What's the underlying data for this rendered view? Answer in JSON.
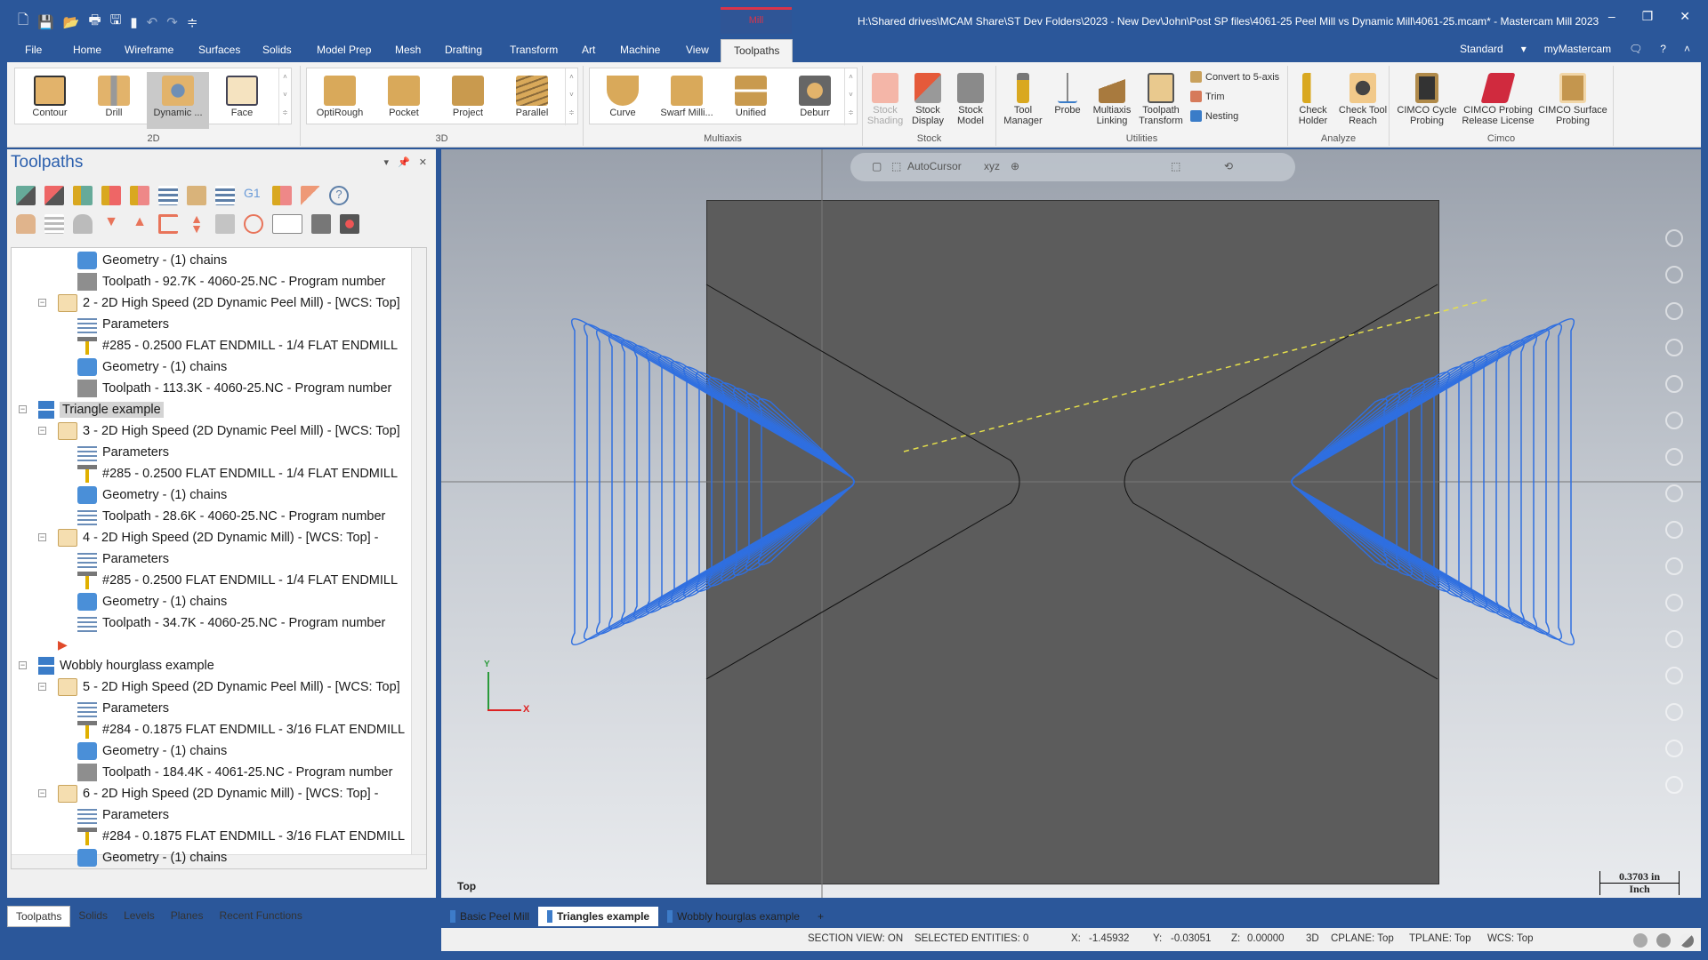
{
  "window": {
    "title": "H:\\Shared drives\\MCAM Share\\ST Dev Folders\\2023 - New Dev\\John\\Post SP files\\4061-25 Peel Mill vs Dynamic Mill\\4061-25.mcam* - Mastercam Mill 2023",
    "context_tab": "Mill",
    "controls": [
      "minimize",
      "restore",
      "close"
    ]
  },
  "quick_access": [
    "new-file-icon",
    "save-icon",
    "open-icon",
    "print-icon",
    "save-as-icon",
    "zip2go-icon",
    "undo-icon",
    "redo-icon",
    "customize-icon"
  ],
  "menu": {
    "items": [
      "File",
      "Home",
      "Wireframe",
      "Surfaces",
      "Solids",
      "Model Prep",
      "Mesh",
      "Drafting",
      "Transform",
      "Art",
      "Machine",
      "View",
      "Toolpaths"
    ],
    "active": "Toolpaths",
    "right": {
      "workspace": "Standard",
      "account": "myMastercam"
    }
  },
  "ribbon": {
    "groups": [
      {
        "label": "2D",
        "buttons": [
          "Contour",
          "Drill",
          "Dynamic ...",
          "Face"
        ],
        "selected": "Dynamic ..."
      },
      {
        "label": "3D",
        "buttons": [
          "OptiRough",
          "Pocket",
          "Project",
          "Parallel"
        ]
      },
      {
        "label": "Multiaxis",
        "buttons": [
          "Curve",
          "Swarf Milli...",
          "Unified",
          "Deburr"
        ]
      },
      {
        "label": "Stock",
        "buttons": [
          "Stock Shading",
          "Stock Display",
          "Stock Model"
        ],
        "disabled": [
          "Stock Shading"
        ]
      },
      {
        "label": "Utilities",
        "buttons": [
          "Tool Manager",
          "Probe",
          "Multiaxis Linking",
          "Toolpath Transform"
        ],
        "small_buttons": [
          "Convert to 5-axis",
          "Trim",
          "Nesting"
        ]
      },
      {
        "label": "Analyze",
        "buttons": [
          "Check Holder",
          "Check Tool Reach"
        ]
      },
      {
        "label": "Cimco",
        "buttons": [
          "CIMCO Cycle Probing",
          "CIMCO Probing Release License",
          "CIMCO Surface Probing"
        ]
      }
    ]
  },
  "panel": {
    "title": "Toolpaths",
    "tree": [
      {
        "indent": 3,
        "icon": "geometry",
        "label": "Geometry - (1) chains"
      },
      {
        "indent": 3,
        "icon": "toolpath",
        "label": "Toolpath - 92.7K - 4060-25.NC - Program number"
      },
      {
        "indent": 2,
        "icon": "folder",
        "label": "2 - 2D High Speed (2D Dynamic Peel Mill) - [WCS: Top]",
        "expander": true
      },
      {
        "indent": 3,
        "icon": "parameters",
        "label": "Parameters"
      },
      {
        "indent": 3,
        "icon": "tool",
        "label": "#285 - 0.2500 FLAT ENDMILL - 1/4 FLAT ENDMILL"
      },
      {
        "indent": 3,
        "icon": "geometry",
        "label": "Geometry - (1) chains"
      },
      {
        "indent": 3,
        "icon": "toolpath",
        "label": "Toolpath - 113.3K - 4060-25.NC - Program number"
      },
      {
        "indent": 1,
        "icon": "group",
        "label": "Triangle example",
        "expander": true,
        "selected": true
      },
      {
        "indent": 2,
        "icon": "folder-check",
        "label": "3 - 2D High Speed (2D Dynamic Peel Mill) - [WCS: Top]",
        "expander": true
      },
      {
        "indent": 3,
        "icon": "parameters",
        "label": "Parameters"
      },
      {
        "indent": 3,
        "icon": "tool",
        "label": "#285 - 0.2500 FLAT ENDMILL - 1/4 FLAT ENDMILL"
      },
      {
        "indent": 3,
        "icon": "geometry",
        "label": "Geometry - (1) chains"
      },
      {
        "indent": 3,
        "icon": "toolpath-wave",
        "label": "Toolpath - 28.6K - 4060-25.NC - Program number"
      },
      {
        "indent": 2,
        "icon": "folder-check",
        "label": "4 - 2D High Speed (2D Dynamic Mill) - [WCS: Top] -",
        "expander": true
      },
      {
        "indent": 3,
        "icon": "parameters",
        "label": "Parameters"
      },
      {
        "indent": 3,
        "icon": "tool",
        "label": "#285 - 0.2500 FLAT ENDMILL - 1/4 FLAT ENDMILL"
      },
      {
        "indent": 3,
        "icon": "geometry",
        "label": "Geometry - (1) chains"
      },
      {
        "indent": 3,
        "icon": "toolpath-wave",
        "label": "Toolpath - 34.7K - 4060-25.NC - Program number"
      },
      {
        "indent": 2,
        "icon": "insert-arrow",
        "label": ""
      },
      {
        "indent": 1,
        "icon": "group",
        "label": "Wobbly hourglass example",
        "expander": true
      },
      {
        "indent": 2,
        "icon": "folder",
        "label": "5 - 2D High Speed (2D Dynamic Peel Mill) - [WCS: Top]",
        "expander": true
      },
      {
        "indent": 3,
        "icon": "parameters",
        "label": "Parameters"
      },
      {
        "indent": 3,
        "icon": "tool",
        "label": "#284 - 0.1875 FLAT ENDMILL - 3/16 FLAT ENDMILL"
      },
      {
        "indent": 3,
        "icon": "geometry",
        "label": "Geometry - (1) chains"
      },
      {
        "indent": 3,
        "icon": "toolpath",
        "label": "Toolpath - 184.4K - 4061-25.NC - Program number"
      },
      {
        "indent": 2,
        "icon": "folder",
        "label": "6 - 2D High Speed (2D Dynamic Mill) - [WCS: Top] -",
        "expander": true
      },
      {
        "indent": 3,
        "icon": "parameters",
        "label": "Parameters"
      },
      {
        "indent": 3,
        "icon": "tool",
        "label": "#284 - 0.1875 FLAT ENDMILL - 3/16 FLAT ENDMILL"
      },
      {
        "indent": 3,
        "icon": "geometry",
        "label": "Geometry - (1) chains"
      }
    ],
    "bottom_tabs": [
      "Toolpaths",
      "Solids",
      "Levels",
      "Planes",
      "Recent Functions"
    ],
    "active_tab": "Toolpaths"
  },
  "viewport": {
    "selection_bar": {
      "autocursor_label": "AutoCursor"
    },
    "view_label": "Top",
    "axes": {
      "y": "Y",
      "x": "X"
    },
    "scale": {
      "value": "0.3703 in",
      "unit": "Inch"
    },
    "colors": {
      "toolpath": "#2f6fe0",
      "stock": "#5c5c5c",
      "rapid": "#e6e04a",
      "plunge": "#b57a3a"
    },
    "tabs": [
      "Basic Peel Mill",
      "Triangles example",
      "Wobbly hourglas example"
    ],
    "active_tab": "Triangles example",
    "add_tab": "+"
  },
  "status": {
    "section_view": "SECTION VIEW: ON",
    "selected": "SELECTED ENTITIES: 0",
    "x_label": "X:",
    "x": "-1.45932",
    "y_label": "Y:",
    "y": "-0.03051",
    "z_label": "Z:",
    "z": "0.00000",
    "mode": "3D",
    "cplane": "CPLANE: Top",
    "tplane": "TPLANE: Top",
    "wcs": "WCS: Top"
  }
}
